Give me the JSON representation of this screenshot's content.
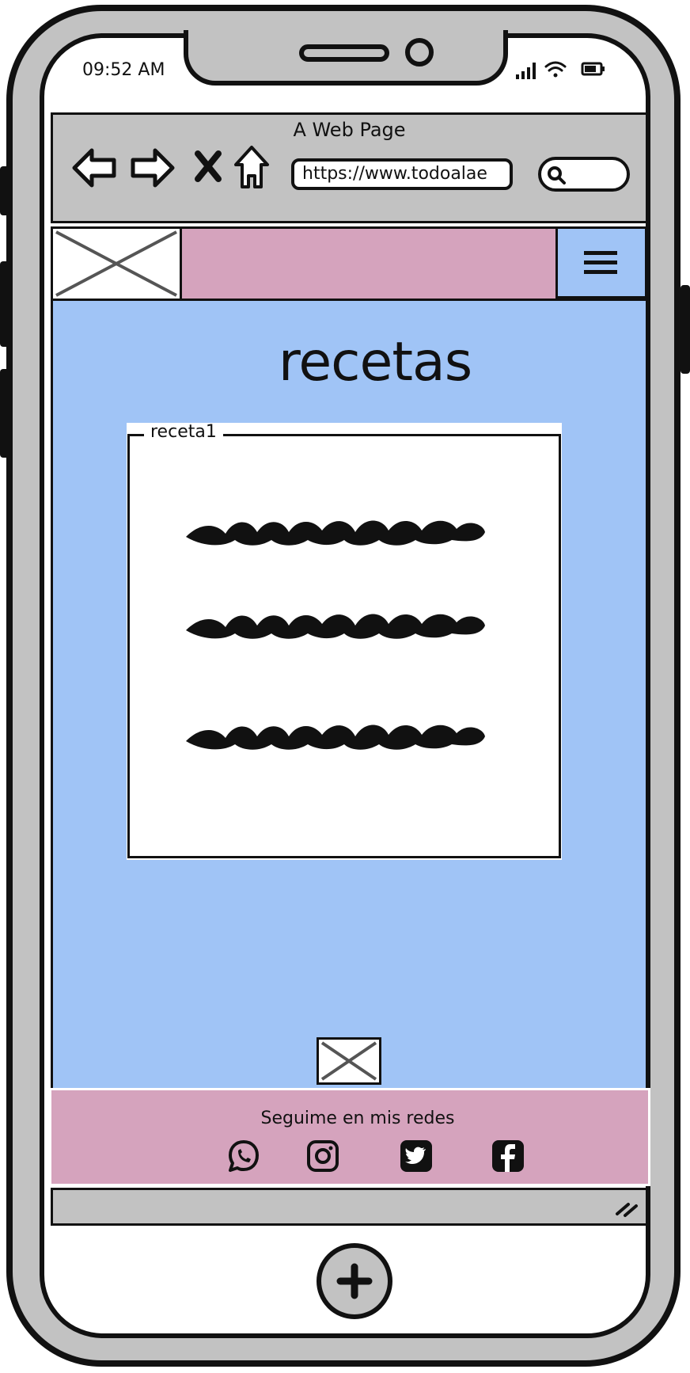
{
  "status_bar": {
    "time": "09:52 AM",
    "icons": [
      "signal-icon",
      "wifi-icon",
      "battery-icon"
    ]
  },
  "browser": {
    "page_title": "A Web Page",
    "url": "https://www.todoalae",
    "nav_icons": [
      "back-arrow-icon",
      "forward-arrow-icon",
      "close-icon",
      "home-icon"
    ],
    "search_icon": "search-icon"
  },
  "header": {
    "logo_image": "image-placeholder",
    "menu_icon": "hamburger-menu-icon"
  },
  "main": {
    "heading": "recetas",
    "card": {
      "legend": "receta1",
      "lines": 3
    }
  },
  "footer": {
    "text": "Seguime en mis redes",
    "social_icons": [
      "whatsapp-icon",
      "instagram-icon",
      "twitter-icon",
      "facebook-icon"
    ]
  },
  "colors": {
    "phone_body": "#c2c2c2",
    "header_band": "#d5a3bd",
    "main_background": "#a0c4f6",
    "footer_background": "#d5a3bd",
    "outline": "#111111"
  }
}
